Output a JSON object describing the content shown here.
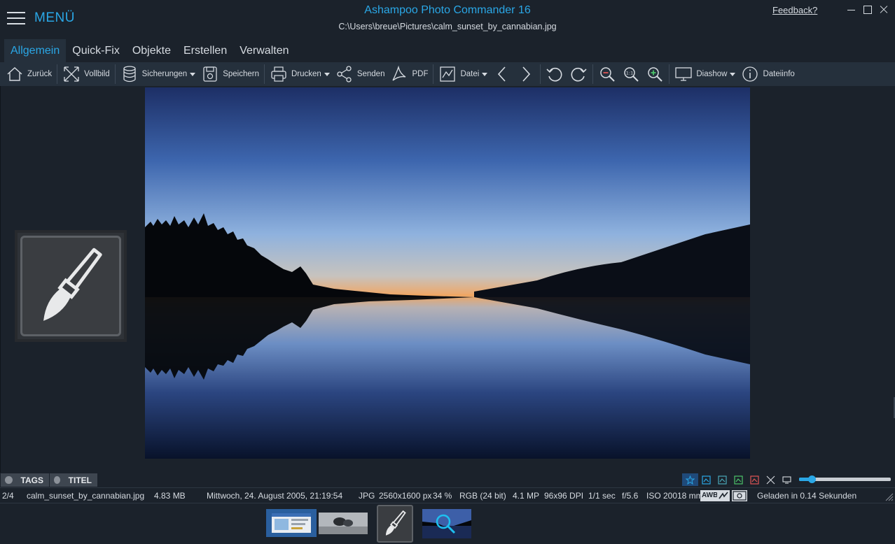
{
  "window": {
    "menu_label": "MENÜ",
    "title": "Ashampoo Photo Commander 16",
    "file_path": "C:\\Users\\breue\\Pictures\\calm_sunset_by_cannabian.jpg",
    "feedback": "Feedback?"
  },
  "tabs": [
    {
      "label": "Allgemein",
      "active": true
    },
    {
      "label": "Quick-Fix"
    },
    {
      "label": "Objekte"
    },
    {
      "label": "Erstellen"
    },
    {
      "label": "Verwalten"
    }
  ],
  "toolbar": {
    "back": "Zurück",
    "fullscreen": "Vollbild",
    "backups": "Sicherungen",
    "save": "Speichern",
    "print": "Drucken",
    "send": "Senden",
    "pdf": "PDF",
    "file": "Datei",
    "slideshow": "Diashow",
    "fileinfo": "Dateiinfo"
  },
  "tags_bar": {
    "tags": "TAGS",
    "title": "TITEL"
  },
  "zoom_slider": {
    "value": 0.14
  },
  "status": {
    "index": "2/4",
    "filename": "calm_sunset_by_cannabian.jpg",
    "filesize": "4.83 MB",
    "date": "Mittwoch, 24. August 2005, 21:19:54",
    "format": "JPG",
    "dimensions": "2560x1600 px",
    "zoom": "34 %",
    "color": "RGB (24 bit)",
    "megapixels": "4.1 MP",
    "dpi": "96x96 DPI",
    "exposure": "1/1 sec",
    "aperture": "f/5.6",
    "iso": "ISO 200",
    "focal": "18 mm",
    "awb": "AWB",
    "loaded": "Geladen in 0.14 Sekunden"
  },
  "colors": {
    "accent": "#2aa7e6",
    "background": "#1b222b",
    "toolbar": "#25303c"
  }
}
